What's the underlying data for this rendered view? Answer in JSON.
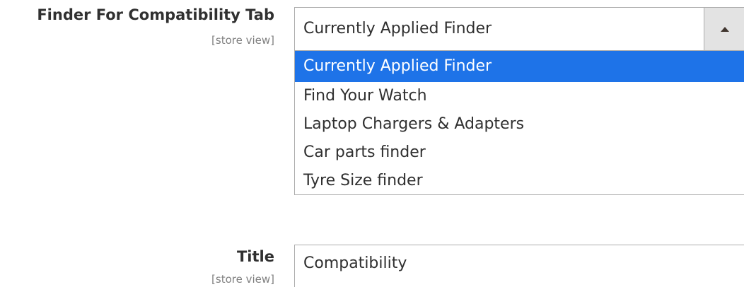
{
  "finder_field": {
    "label": "Finder For Compatibility Tab",
    "scope": "[store view]",
    "selected_value": "Currently Applied Finder",
    "options": [
      {
        "label": "Currently Applied Finder",
        "selected": true
      },
      {
        "label": "Find Your Watch",
        "selected": false
      },
      {
        "label": "Laptop Chargers & Adapters",
        "selected": false
      },
      {
        "label": "Car parts finder",
        "selected": false
      },
      {
        "label": "Tyre Size finder",
        "selected": false
      }
    ],
    "toggle_icon": "triangle-up-icon"
  },
  "title_field": {
    "label": "Title",
    "scope": "[store view]",
    "value": "Compatibility"
  },
  "colors": {
    "selected_option_bg": "#1e73e8",
    "toggle_bg": "#e3e3e3",
    "border": "#adadad",
    "scope_text": "#808080"
  }
}
